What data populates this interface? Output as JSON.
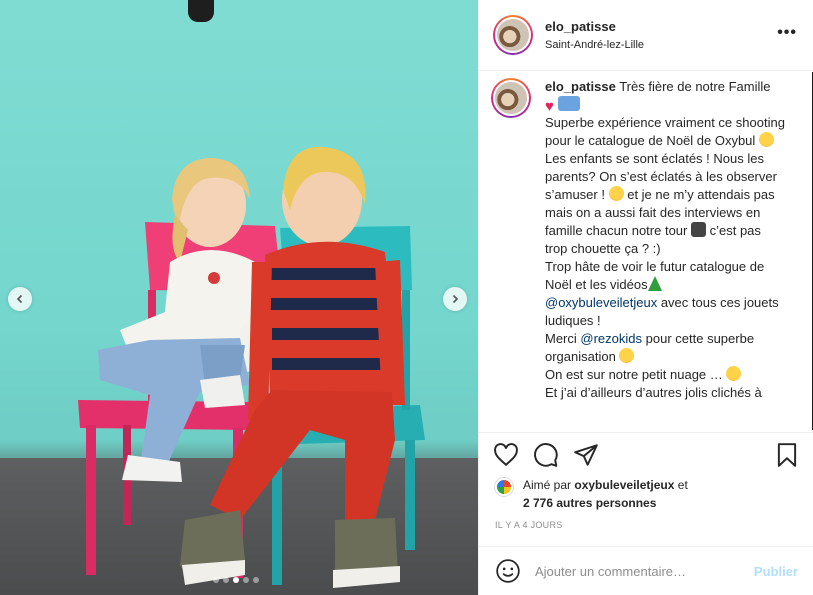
{
  "post": {
    "username": "elo_patisse",
    "location": "Saint-André-lez-Lille",
    "more_label": "•••"
  },
  "caption": {
    "author": "elo_patisse",
    "segments": {
      "s1": "Très fière de notre Famille",
      "s2": "Superbe expérience vraiment ce shooting pour le catalogue de Noël de Oxybul",
      "s3": "Les enfants se sont éclatés ! Nous les parents? On s’est éclatés à les observer s’amuser !",
      "s4": "et je ne m’y attendais pas mais on a aussi fait des interviews en famille chacun notre tour",
      "s5": "c’est pas trop chouette ça ? :)",
      "s6": "Trop hâte de voir le futur catalogue de Noël et les vidéos",
      "mention1": "@oxybuleveiletjeux",
      "s7": "avec tous ces jouets ludiques !",
      "s8": "Merci",
      "mention2": "@rezokids",
      "s9": "pour cette superbe organisation",
      "s10": "On est sur notre petit nuage …",
      "s11": "Et j’ai d’ailleurs d’autres jolis clichés à"
    }
  },
  "likes": {
    "prefix": "Aimé par",
    "user": "oxybuleveiletjeux",
    "conj": "et",
    "others": "2 776 autres personnes"
  },
  "timestamp": "IL Y A 4 JOURS",
  "comment_box": {
    "placeholder": "Ajouter un commentaire…",
    "publish_label": "Publier"
  },
  "carousel": {
    "slide_count": 5,
    "active_index": 2
  },
  "colors": {
    "accent": "#0095f6",
    "publish_disabled": "#b2dffc",
    "backdrop": "#76d8cf"
  }
}
